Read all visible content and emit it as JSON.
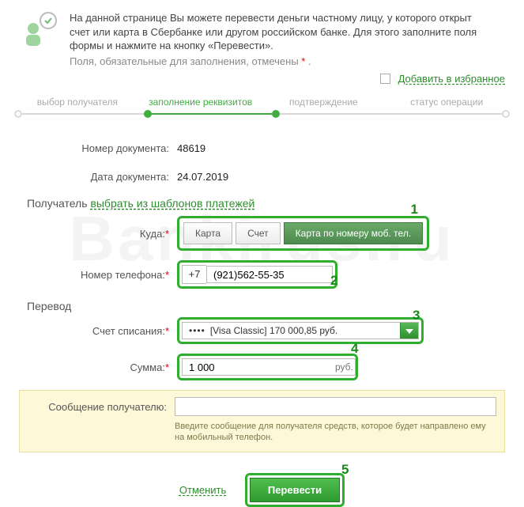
{
  "header": {
    "line1": "На данной странице Вы можете перевести деньги частному лицу, у которого открыт",
    "line2": "счет или карта в Сбербанке или другом российском банке. Для этого заполните поля",
    "line3": "формы и нажмите на кнопку «Перевести».",
    "hint_prefix": "Поля, обязательные для заполнения, отмечены ",
    "hint_ast": "*",
    "hint_suffix": " ."
  },
  "favorites": {
    "label": "Добавить в избранное"
  },
  "steps": {
    "s1": "выбор получателя",
    "s2": "заполнение реквизитов",
    "s3": "подтверждение",
    "s4": "статус операции"
  },
  "doc": {
    "number_label": "Номер документа:",
    "number_value": "48619",
    "date_label": "Дата документа:",
    "date_value": "24.07.2019"
  },
  "recipient": {
    "section": "Получатель",
    "templates_link": "выбрать из шаблонов платежей",
    "where_label": "Куда:",
    "opt_card": "Карта",
    "opt_account": "Счет",
    "opt_mobile": "Карта по номеру моб. тел.",
    "phone_label": "Номер телефона:",
    "phone_prefix": "+7",
    "phone_value": "(921)562-55-35"
  },
  "transfer": {
    "section": "Перевод",
    "from_label": "Счет списания:",
    "from_masked": "••••",
    "from_value": "[Visa Classic] 170 000,85  руб.",
    "sum_label": "Сумма:",
    "sum_value": "1 000",
    "sum_unit": "руб."
  },
  "message": {
    "label": "Сообщение получателю:",
    "value": "",
    "hint": "Введите сообщение для получателя средств, которое будет направлено ему на мобильный телефон."
  },
  "footer": {
    "cancel": "Отменить",
    "submit": "Перевести"
  },
  "callouts": {
    "c1": "1",
    "c2": "2",
    "c3": "3",
    "c4": "4",
    "c5": "5"
  },
  "watermark": "Bankirus.ru"
}
